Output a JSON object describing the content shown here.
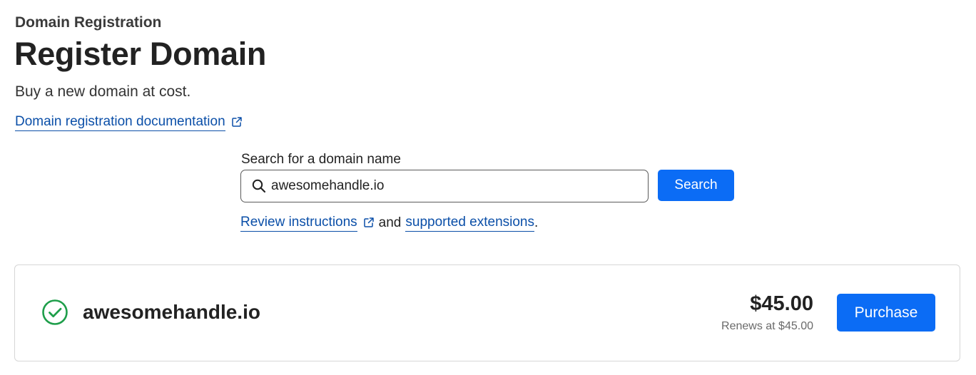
{
  "header": {
    "eyebrow": "Domain Registration",
    "title": "Register Domain",
    "subtitle": "Buy a new domain at cost.",
    "doc_link": "Domain registration documentation"
  },
  "search": {
    "label": "Search for a domain name",
    "value": "awesomehandle.io",
    "button_label": "Search",
    "help": {
      "review_link": "Review instructions",
      "connector": "and",
      "extensions_link": "supported extensions",
      "trailing": "."
    }
  },
  "result": {
    "domain": "awesomehandle.io",
    "status_icon": "check-circle-icon",
    "price": "$45.00",
    "renews": "Renews at $45.00",
    "purchase_label": "Purchase"
  },
  "icons": {
    "search": "search-icon",
    "external": "external-link-icon"
  },
  "colors": {
    "primary_button": "#0b6cf5",
    "link": "#0b4fa8",
    "success": "#1e9e4a"
  }
}
